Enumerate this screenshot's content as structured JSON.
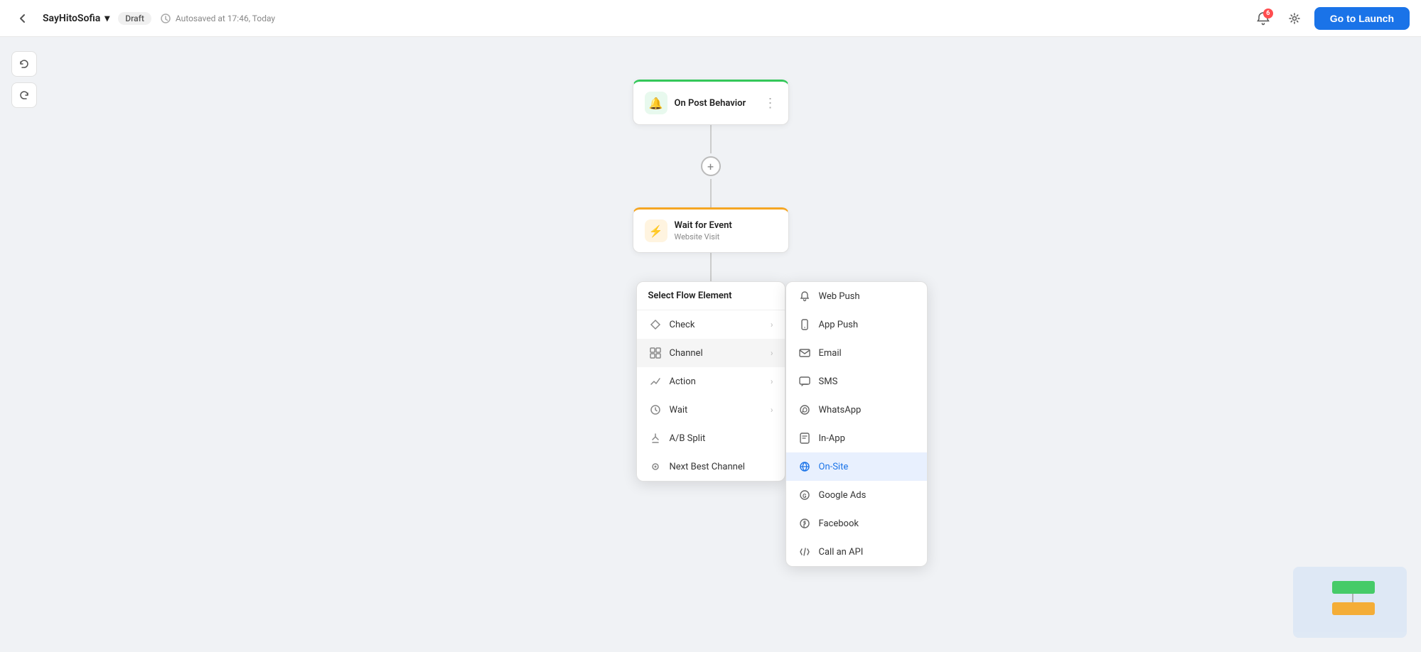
{
  "topbar": {
    "back_label": "←",
    "project_name": "SayHitoSofia",
    "dropdown_icon": "▾",
    "draft_label": "Draft",
    "autosave_label": "Autosaved at 17:46, Today",
    "notif_count": "6",
    "launch_button_label": "Go to Launch"
  },
  "toolbar": {
    "undo_icon": "↺",
    "redo_icon": "↻"
  },
  "flow": {
    "nodes": [
      {
        "id": "on-post-behavior",
        "title": "On Post Behavior",
        "subtitle": "",
        "icon": "🔔",
        "icon_class": "green-bg",
        "border_class": "green-top"
      },
      {
        "id": "wait-for-event",
        "title": "Wait for Event",
        "subtitle": "Website Visit",
        "icon": "⚡",
        "icon_class": "orange-bg",
        "border_class": "orange-top"
      }
    ],
    "add_label": "+"
  },
  "select_flow_element": {
    "header": "Select Flow Element",
    "items": [
      {
        "id": "check",
        "label": "Check",
        "icon": "◇",
        "has_submenu": true
      },
      {
        "id": "channel",
        "label": "Channel",
        "icon": "⊞",
        "has_submenu": true
      },
      {
        "id": "action",
        "label": "Action",
        "icon": "✏",
        "has_submenu": true
      },
      {
        "id": "wait",
        "label": "Wait",
        "icon": "⏱",
        "has_submenu": true
      },
      {
        "id": "ab-split",
        "label": "A/B Split",
        "icon": "⑆",
        "has_submenu": false
      },
      {
        "id": "next-best-channel",
        "label": "Next Best Channel",
        "icon": "⊙",
        "has_submenu": false
      }
    ]
  },
  "channel_submenu": {
    "items": [
      {
        "id": "web-push",
        "label": "Web Push",
        "icon": "🔔",
        "active": false
      },
      {
        "id": "app-push",
        "label": "App Push",
        "icon": "📱",
        "active": false
      },
      {
        "id": "email",
        "label": "Email",
        "icon": "✉",
        "active": false
      },
      {
        "id": "sms",
        "label": "SMS",
        "icon": "💬",
        "active": false
      },
      {
        "id": "whatsapp",
        "label": "WhatsApp",
        "icon": "💬",
        "active": false
      },
      {
        "id": "in-app",
        "label": "In-App",
        "icon": "📲",
        "active": false
      },
      {
        "id": "on-site",
        "label": "On-Site",
        "icon": "🌐",
        "active": true
      },
      {
        "id": "google-ads",
        "label": "Google Ads",
        "icon": "G",
        "active": false
      },
      {
        "id": "facebook",
        "label": "Facebook",
        "icon": "f",
        "active": false
      },
      {
        "id": "call-an-api",
        "label": "Call an API",
        "icon": "</>",
        "active": false
      }
    ]
  },
  "minimap": {
    "visible": true
  }
}
